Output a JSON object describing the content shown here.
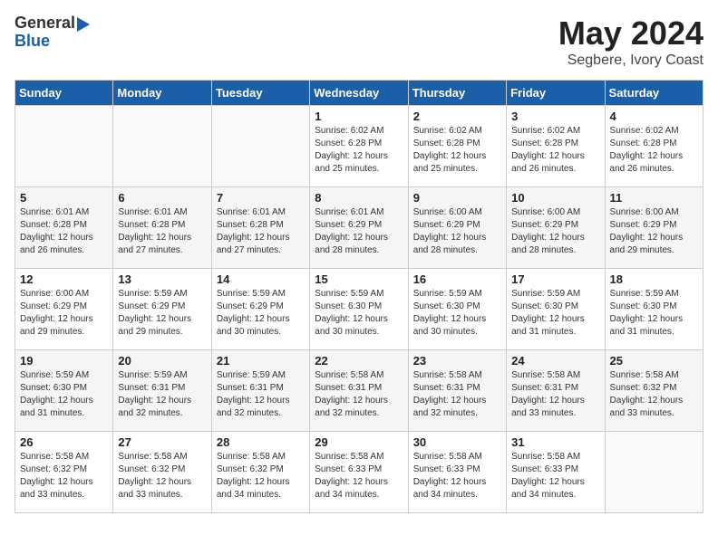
{
  "header": {
    "logo_general": "General",
    "logo_blue": "Blue",
    "month_year": "May 2024",
    "location": "Segbere, Ivory Coast"
  },
  "weekdays": [
    "Sunday",
    "Monday",
    "Tuesday",
    "Wednesday",
    "Thursday",
    "Friday",
    "Saturday"
  ],
  "weeks": [
    [
      {
        "day": "",
        "info": ""
      },
      {
        "day": "",
        "info": ""
      },
      {
        "day": "",
        "info": ""
      },
      {
        "day": "1",
        "info": "Sunrise: 6:02 AM\nSunset: 6:28 PM\nDaylight: 12 hours\nand 25 minutes."
      },
      {
        "day": "2",
        "info": "Sunrise: 6:02 AM\nSunset: 6:28 PM\nDaylight: 12 hours\nand 25 minutes."
      },
      {
        "day": "3",
        "info": "Sunrise: 6:02 AM\nSunset: 6:28 PM\nDaylight: 12 hours\nand 26 minutes."
      },
      {
        "day": "4",
        "info": "Sunrise: 6:02 AM\nSunset: 6:28 PM\nDaylight: 12 hours\nand 26 minutes."
      }
    ],
    [
      {
        "day": "5",
        "info": "Sunrise: 6:01 AM\nSunset: 6:28 PM\nDaylight: 12 hours\nand 26 minutes."
      },
      {
        "day": "6",
        "info": "Sunrise: 6:01 AM\nSunset: 6:28 PM\nDaylight: 12 hours\nand 27 minutes."
      },
      {
        "day": "7",
        "info": "Sunrise: 6:01 AM\nSunset: 6:28 PM\nDaylight: 12 hours\nand 27 minutes."
      },
      {
        "day": "8",
        "info": "Sunrise: 6:01 AM\nSunset: 6:29 PM\nDaylight: 12 hours\nand 28 minutes."
      },
      {
        "day": "9",
        "info": "Sunrise: 6:00 AM\nSunset: 6:29 PM\nDaylight: 12 hours\nand 28 minutes."
      },
      {
        "day": "10",
        "info": "Sunrise: 6:00 AM\nSunset: 6:29 PM\nDaylight: 12 hours\nand 28 minutes."
      },
      {
        "day": "11",
        "info": "Sunrise: 6:00 AM\nSunset: 6:29 PM\nDaylight: 12 hours\nand 29 minutes."
      }
    ],
    [
      {
        "day": "12",
        "info": "Sunrise: 6:00 AM\nSunset: 6:29 PM\nDaylight: 12 hours\nand 29 minutes."
      },
      {
        "day": "13",
        "info": "Sunrise: 5:59 AM\nSunset: 6:29 PM\nDaylight: 12 hours\nand 29 minutes."
      },
      {
        "day": "14",
        "info": "Sunrise: 5:59 AM\nSunset: 6:29 PM\nDaylight: 12 hours\nand 30 minutes."
      },
      {
        "day": "15",
        "info": "Sunrise: 5:59 AM\nSunset: 6:30 PM\nDaylight: 12 hours\nand 30 minutes."
      },
      {
        "day": "16",
        "info": "Sunrise: 5:59 AM\nSunset: 6:30 PM\nDaylight: 12 hours\nand 30 minutes."
      },
      {
        "day": "17",
        "info": "Sunrise: 5:59 AM\nSunset: 6:30 PM\nDaylight: 12 hours\nand 31 minutes."
      },
      {
        "day": "18",
        "info": "Sunrise: 5:59 AM\nSunset: 6:30 PM\nDaylight: 12 hours\nand 31 minutes."
      }
    ],
    [
      {
        "day": "19",
        "info": "Sunrise: 5:59 AM\nSunset: 6:30 PM\nDaylight: 12 hours\nand 31 minutes."
      },
      {
        "day": "20",
        "info": "Sunrise: 5:59 AM\nSunset: 6:31 PM\nDaylight: 12 hours\nand 32 minutes."
      },
      {
        "day": "21",
        "info": "Sunrise: 5:59 AM\nSunset: 6:31 PM\nDaylight: 12 hours\nand 32 minutes."
      },
      {
        "day": "22",
        "info": "Sunrise: 5:58 AM\nSunset: 6:31 PM\nDaylight: 12 hours\nand 32 minutes."
      },
      {
        "day": "23",
        "info": "Sunrise: 5:58 AM\nSunset: 6:31 PM\nDaylight: 12 hours\nand 32 minutes."
      },
      {
        "day": "24",
        "info": "Sunrise: 5:58 AM\nSunset: 6:31 PM\nDaylight: 12 hours\nand 33 minutes."
      },
      {
        "day": "25",
        "info": "Sunrise: 5:58 AM\nSunset: 6:32 PM\nDaylight: 12 hours\nand 33 minutes."
      }
    ],
    [
      {
        "day": "26",
        "info": "Sunrise: 5:58 AM\nSunset: 6:32 PM\nDaylight: 12 hours\nand 33 minutes."
      },
      {
        "day": "27",
        "info": "Sunrise: 5:58 AM\nSunset: 6:32 PM\nDaylight: 12 hours\nand 33 minutes."
      },
      {
        "day": "28",
        "info": "Sunrise: 5:58 AM\nSunset: 6:32 PM\nDaylight: 12 hours\nand 34 minutes."
      },
      {
        "day": "29",
        "info": "Sunrise: 5:58 AM\nSunset: 6:33 PM\nDaylight: 12 hours\nand 34 minutes."
      },
      {
        "day": "30",
        "info": "Sunrise: 5:58 AM\nSunset: 6:33 PM\nDaylight: 12 hours\nand 34 minutes."
      },
      {
        "day": "31",
        "info": "Sunrise: 5:58 AM\nSunset: 6:33 PM\nDaylight: 12 hours\nand 34 minutes."
      },
      {
        "day": "",
        "info": ""
      }
    ]
  ]
}
